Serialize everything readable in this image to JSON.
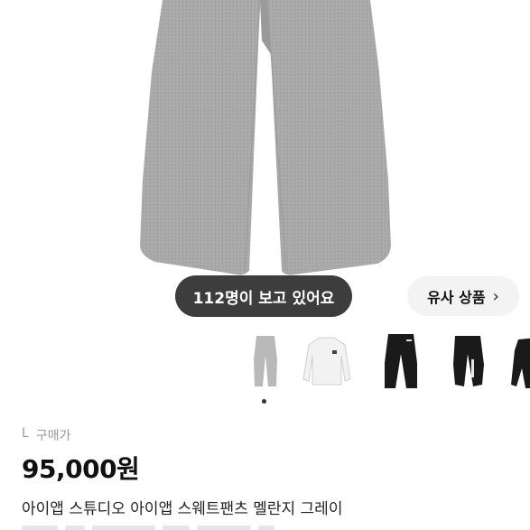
{
  "hero": {
    "viewers_text": "112명이 보고 있어요",
    "similar_label": "유사 상품",
    "similar_chevron": "›"
  },
  "thumbnails": [
    {
      "name": "grey-sweatpants-thumb",
      "color": "#b9b9b9"
    },
    {
      "name": "white-shirt-thumb",
      "color": "#f2f2f2"
    },
    {
      "name": "black-pants-thumb",
      "color": "#1a1a1a"
    },
    {
      "name": "black-jogger-thumb",
      "color": "#1a1a1a"
    },
    {
      "name": "black-top-thumb",
      "color": "#1a1a1a"
    }
  ],
  "pager": {
    "active_index": 0,
    "count": 2
  },
  "product": {
    "condition_grade": "L",
    "condition_label": "구매가",
    "price": "95,000원",
    "title": "아이앱 스튜디오 아이앱 스웨트팬츠 멜란지 그레이"
  },
  "colors": {
    "pill_dark": "#222222",
    "pill_light": "#f3f3f3",
    "grey_melange": "#a9a9a9"
  }
}
